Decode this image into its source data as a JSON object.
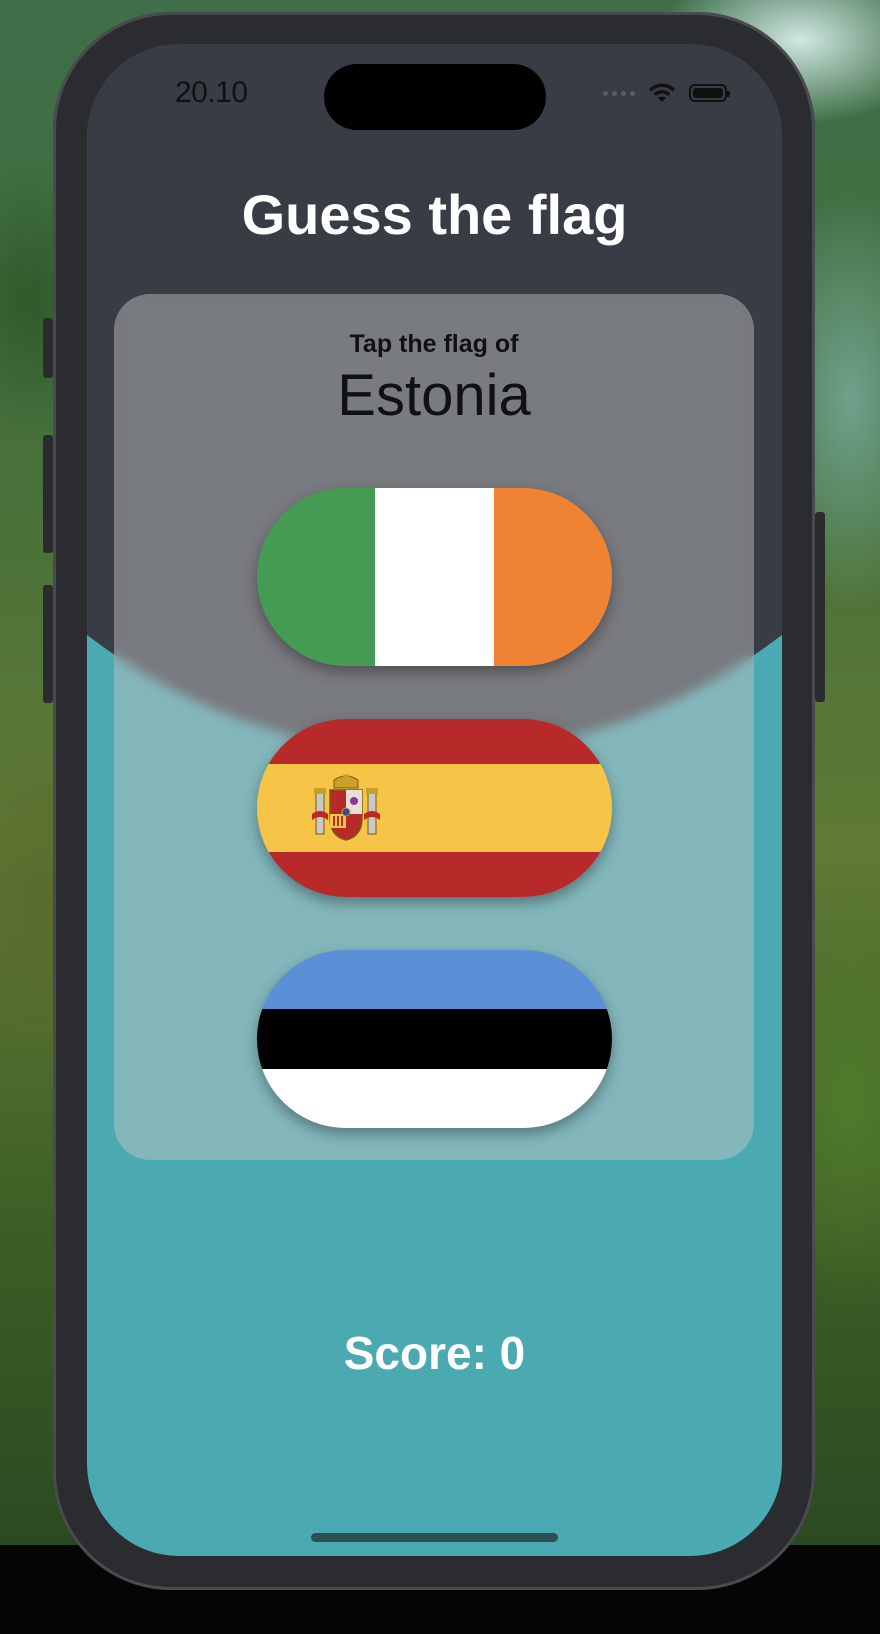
{
  "status_bar": {
    "time": "20.10",
    "signal_icon": "cellular-dots-icon",
    "wifi_icon": "wifi-icon",
    "battery_icon": "battery-icon"
  },
  "header": {
    "title": "Guess the flag"
  },
  "prompt": {
    "subtitle": "Tap the flag of",
    "country": "Estonia"
  },
  "flags": [
    {
      "country": "Ireland",
      "colors": [
        "#459b52",
        "#ffffff",
        "#ef8233"
      ]
    },
    {
      "country": "Spain",
      "colors": [
        "#b72a29",
        "#f6c547",
        "#b72a29"
      ]
    },
    {
      "country": "Estonia",
      "colors": [
        "#5b8fd6",
        "#000000",
        "#ffffff"
      ]
    }
  ],
  "score": {
    "label": "Score: 0"
  },
  "colors": {
    "screen_top": "#383c44",
    "screen_bottom": "#4ba9b2",
    "card": "rgba(200,200,200,0.45)"
  }
}
